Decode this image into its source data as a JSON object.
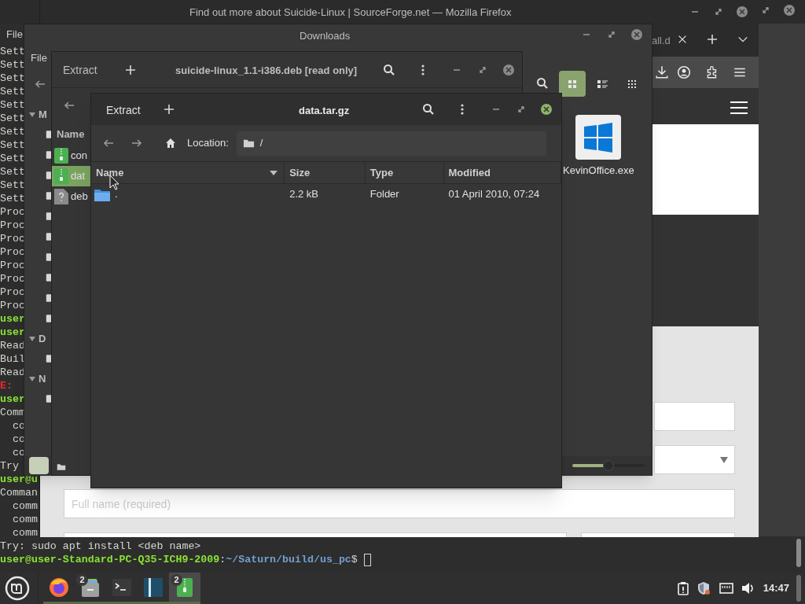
{
  "terminal": {
    "menu": [
      "File"
    ],
    "cursor": true,
    "lines": [
      {
        "segments": [
          {
            "kind": "plain",
            "text": "Sett"
          }
        ]
      },
      {
        "segments": [
          {
            "kind": "plain",
            "text": "Sett"
          }
        ]
      },
      {
        "segments": [
          {
            "kind": "plain",
            "text": "Sett"
          }
        ]
      },
      {
        "segments": [
          {
            "kind": "plain",
            "text": "Sett"
          }
        ]
      },
      {
        "segments": [
          {
            "kind": "plain",
            "text": "Sett"
          }
        ]
      },
      {
        "segments": [
          {
            "kind": "plain",
            "text": "Sett"
          }
        ]
      },
      {
        "segments": [
          {
            "kind": "plain",
            "text": "Sett"
          }
        ]
      },
      {
        "segments": [
          {
            "kind": "plain",
            "text": "Sett"
          }
        ]
      },
      {
        "segments": [
          {
            "kind": "plain",
            "text": "Sett"
          }
        ]
      },
      {
        "segments": [
          {
            "kind": "plain",
            "text": "Sett"
          }
        ]
      },
      {
        "segments": [
          {
            "kind": "plain",
            "text": "Sett"
          }
        ]
      },
      {
        "segments": [
          {
            "kind": "plain",
            "text": "Sett"
          }
        ]
      },
      {
        "segments": [
          {
            "kind": "plain",
            "text": "Proc"
          }
        ]
      },
      {
        "segments": [
          {
            "kind": "plain",
            "text": "Proc"
          }
        ]
      },
      {
        "segments": [
          {
            "kind": "plain",
            "text": "Proc"
          }
        ]
      },
      {
        "segments": [
          {
            "kind": "plain",
            "text": "Proc"
          }
        ]
      },
      {
        "segments": [
          {
            "kind": "plain",
            "text": "Proc"
          }
        ]
      },
      {
        "segments": [
          {
            "kind": "plain",
            "text": "Proc"
          }
        ]
      },
      {
        "segments": [
          {
            "kind": "plain",
            "text": "Proc"
          }
        ]
      },
      {
        "segments": [
          {
            "kind": "plain",
            "text": "Proc"
          }
        ]
      },
      {
        "segments": [
          {
            "kind": "user",
            "text": "user"
          }
        ]
      },
      {
        "segments": [
          {
            "kind": "user",
            "text": "user"
          }
        ]
      },
      {
        "segments": [
          {
            "kind": "plain",
            "text": "Read"
          }
        ]
      },
      {
        "segments": [
          {
            "kind": "plain",
            "text": "Buil"
          }
        ]
      },
      {
        "segments": [
          {
            "kind": "plain",
            "text": "Read"
          }
        ]
      },
      {
        "segments": [
          {
            "kind": "error",
            "text": "E:"
          }
        ]
      },
      {
        "segments": [
          {
            "kind": "user",
            "text": "user"
          }
        ]
      },
      {
        "segments": [
          {
            "kind": "plain",
            "text": "Comm"
          }
        ]
      },
      {
        "segments": [
          {
            "kind": "plain",
            "text": "  co"
          }
        ]
      },
      {
        "segments": [
          {
            "kind": "plain",
            "text": "  co"
          }
        ]
      },
      {
        "segments": [
          {
            "kind": "plain",
            "text": "  co"
          }
        ]
      },
      {
        "segments": [
          {
            "kind": "plain",
            "text": "Try"
          }
        ]
      },
      {
        "segments": [
          {
            "kind": "user",
            "text": "user@u"
          }
        ]
      },
      {
        "segments": [
          {
            "kind": "plain",
            "text": "Comman"
          }
        ]
      },
      {
        "segments": [
          {
            "kind": "plain",
            "text": "  comm"
          }
        ]
      },
      {
        "segments": [
          {
            "kind": "plain",
            "text": "  comm"
          }
        ]
      },
      {
        "segments": [
          {
            "kind": "plain",
            "text": "  comm"
          }
        ]
      },
      {
        "segments": [
          {
            "kind": "plain",
            "text": "Try: sudo apt install <deb name>"
          }
        ]
      },
      {
        "segments": [
          {
            "kind": "user",
            "text": "user@user-Standard-PC-Q35-ICH9-2009"
          },
          {
            "kind": "plain",
            "text": ":"
          },
          {
            "kind": "path",
            "text": "~/Saturn/build/us_pc"
          },
          {
            "kind": "plain",
            "text": "$ "
          }
        ]
      }
    ]
  },
  "firefox": {
    "title": "Find out more about Suicide-Linux | SourceForge.net — Mozilla Firefox",
    "tab": {
      "label": "all.d"
    },
    "page": {
      "placeholder": "Full name (required)"
    }
  },
  "downloads": {
    "title": "Downloads",
    "menu": [
      "File"
    ],
    "sidebar": [
      {
        "label": "M"
      },
      {
        "label": "D"
      },
      {
        "label": "N"
      }
    ],
    "views": [
      {
        "kind": "icons",
        "selected": true
      },
      {
        "kind": "list",
        "selected": false
      },
      {
        "kind": "compact",
        "selected": false
      }
    ],
    "files": [
      {
        "name": "KevinOffice.exe"
      }
    ],
    "zoom": {
      "level": 0.5
    }
  },
  "archive_back": {
    "button": "Extract",
    "title": "suicide-linux_1.1-i386.deb [read only]",
    "column": "Name",
    "rows": [
      {
        "name": "con",
        "kind": "archive",
        "selected": false
      },
      {
        "name": "dat",
        "kind": "archive",
        "selected": true
      },
      {
        "name": "deb",
        "kind": "unknown",
        "selected": false
      }
    ]
  },
  "archive_front": {
    "button": "Extract",
    "title": "data.tar.gz",
    "location_label": "Location:",
    "location": "/",
    "columns": [
      {
        "label": "Name",
        "sorted": true
      },
      {
        "label": "Size",
        "sorted": false
      },
      {
        "label": "Type",
        "sorted": false
      },
      {
        "label": "Modified",
        "sorted": false
      }
    ],
    "rows": [
      {
        "name": ".",
        "size": "2.2 kB",
        "type": "Folder",
        "modified": "01 April 2010, 07:24",
        "selected": false
      }
    ]
  },
  "taskbar": {
    "apps": [
      {
        "kind": "firefox",
        "selected": false
      },
      {
        "kind": "files",
        "badge": "2",
        "selected": false
      },
      {
        "kind": "terminal",
        "selected": false
      },
      {
        "kind": "editor",
        "selected": false
      },
      {
        "kind": "archive",
        "badge": "2",
        "selected": true
      }
    ],
    "clock": "14:47"
  }
}
